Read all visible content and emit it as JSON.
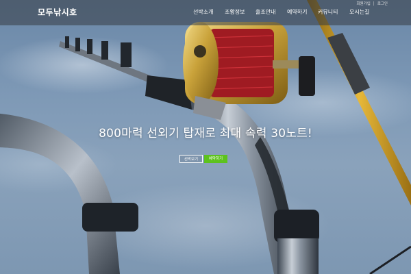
{
  "brand": {
    "logo_text": "모두낚시호"
  },
  "utility_links": {
    "signup": "회원가입",
    "separator": "|",
    "login": "로그인"
  },
  "nav": {
    "items": [
      {
        "label": "선박소개"
      },
      {
        "label": "조황정보"
      },
      {
        "label": "출조안내"
      },
      {
        "label": "예약하기"
      },
      {
        "label": "커뮤니티"
      },
      {
        "label": "오시는길"
      }
    ]
  },
  "hero": {
    "headline": "800마력 선외기 탑재로 최대 속력 30노트!",
    "buttons": {
      "primary": "선박보기",
      "secondary": "예약하기"
    },
    "background_image": "fishing-rod-and-reel-against-sky"
  },
  "colors": {
    "topbar": "#373c44",
    "accent_green": "#5dc21e",
    "reel_gold": "#c9a23a",
    "reel_red": "#c0232a",
    "rod_gold": "#d9a21d"
  }
}
